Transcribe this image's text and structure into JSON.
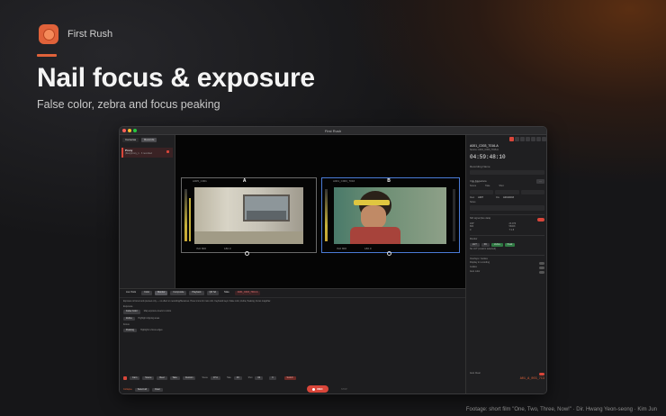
{
  "brand": {
    "name": "First Rush"
  },
  "headline": "Nail focus & exposure",
  "subhead": "False color, zebra and focus peaking",
  "footer": {
    "credit": "Footage: short film \"One, Two, Three, Now!\" · Dir. Hwang Yeon-seong · Kim Jun"
  },
  "colors": {
    "accent": "#e0623a",
    "record": "#d9463a",
    "preview_border": "#4a7bd6",
    "background": "#161618"
  },
  "app": {
    "window_title": "First Rush",
    "sidebar": {
      "tabs": [
        "Cameras",
        "Records"
      ],
      "item": {
        "name": "Proxy",
        "sub": "(files)/proxy_1 · 3 recorded"
      }
    },
    "viewer": {
      "left": {
        "clip": "A005_C001",
        "letter": "A",
        "iso": "ISO 800",
        "shutter": "180.0"
      },
      "right": {
        "clip": "A001_C003_7016",
        "letter": "B",
        "iso": "ISO 800",
        "shutter": "180.0"
      }
    },
    "inspector": {
      "clip_name": "A001_C003_7016-A",
      "clip_sub": "Source: A001_C003_7016-A",
      "timecode": "04:59:48:10",
      "recording_name_label": "Recording Name",
      "recording_name_placeholder": "Untitled",
      "clip_metadata_label": "Clip Metadata",
      "meta_headers": [
        "Scene",
        "Take",
        "Shot"
      ],
      "reel_label": "Reel",
      "reel_value": "A007",
      "file_label": "File",
      "file_value": "A001C003",
      "notes_label": "Notes",
      "sdi_label": "SDI signal (live data)",
      "sdi_stats": [
        {
          "k": "Shutter",
          "v": "180°"
        },
        {
          "k": "Fps",
          "v": "23.976"
        },
        {
          "k": "ISO",
          "v": "800"
        },
        {
          "k": "WB",
          "v": "5600K"
        },
        {
          "k": "Tint",
          "v": "0"
        },
        {
          "k": "Lens",
          "v": "T 2.8"
        }
      ],
      "monitor_label": "Monitor",
      "tags": [
        "LUT",
        "FC",
        "Zebra",
        "Peak"
      ],
      "no_lut": "No LUT (custom selected)",
      "overlays_label": "Overlays / Guides",
      "overlay_opts": [
        "Display in recording",
        "Guides",
        "Auto color"
      ]
    },
    "bottom": {
      "tabs": [
        "Live Tools",
        "Color",
        "Monitor",
        "Composite",
        "Playback",
        "QR Sd",
        "Slate"
      ],
      "active_tab": "Monitor",
      "slate_value": "A001_C003_7016-A",
      "hint": "Exposure & focus tools preview only — no effect on recording/filenames. Hover icons for more info. Keyboard keys: False color, Zebra, Peaking, Focus magnifier.",
      "exposure_label": "Exposure",
      "false_color_btn": "False Color",
      "false_color_desc": "Map exposure levels to colors",
      "zebra_btn": "Zebra",
      "zebra_desc": "Highlight clipping areas",
      "focus_label": "Focus",
      "peaking_btn": "Peaking",
      "peaking_desc": "Highlight in-focus edges",
      "transport": [
        "Cam",
        "Scene",
        "Reel",
        "Take",
        "Custom"
      ],
      "fields": [
        {
          "label": "Scene",
          "value": "07 A"
        },
        {
          "label": "Take",
          "value": "03"
        },
        {
          "label": "Shot",
          "value": "02"
        }
      ],
      "reel_num": "3",
      "auto_clear": "Auto Clear",
      "rec_label": "REC",
      "next_name": "A01_A_003_7C3",
      "collapse": "Collapse",
      "select_all": "Select all",
      "clear": "Clear",
      "switch_label": "Switch",
      "stop_label": "STOP"
    }
  }
}
